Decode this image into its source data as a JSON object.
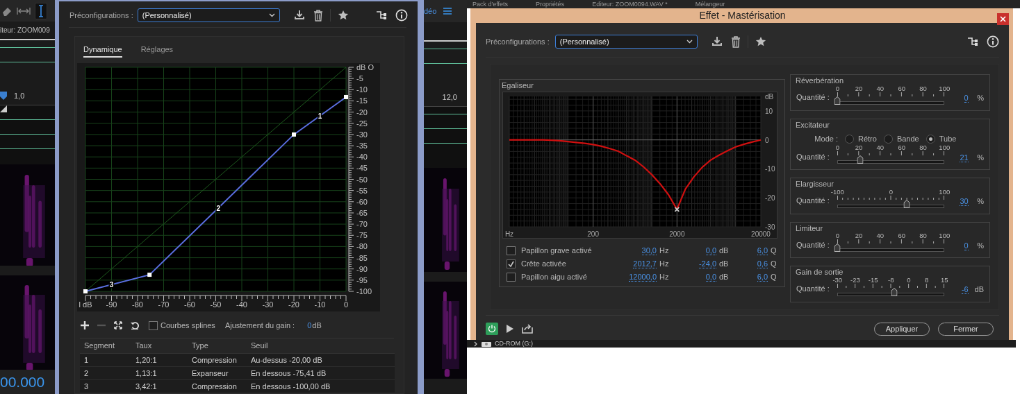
{
  "background": {
    "left_strip": {
      "editor_label": "iteur: ZOOM009",
      "ruler_label": "1,0",
      "time": "00.000"
    },
    "right_strip": {
      "tab_label": "déo",
      "ruler_label": "12,0"
    },
    "top_tabs": [
      "Pack d'effets",
      "Propriétés",
      "Editeur: ZOOM0094.WAV *",
      "Mélangeur"
    ],
    "drive": "CD-ROM (G:)"
  },
  "dynamics_dialog": {
    "presets_label": "Préconfigurations :",
    "preset": "(Personnalisé)",
    "tabs": [
      {
        "label": "Dynamique",
        "selected": true
      },
      {
        "label": "Réglages",
        "selected": false
      }
    ],
    "chart_data": {
      "type": "line",
      "grid": true,
      "x": [
        -100,
        -75.41,
        -20,
        0
      ],
      "series": [
        {
          "color": "#5a6ee0",
          "marker": "square",
          "values": [
            -100,
            -92.6,
            -30,
            -13.3
          ]
        },
        {
          "color": "#1d5a1d",
          "values": [
            -100,
            -75.4,
            -20,
            0
          ]
        }
      ],
      "xlim": [
        -100,
        0
      ],
      "ylim": [
        -100,
        0
      ],
      "xticks": [
        {
          "value": -100,
          "label": "l dB"
        },
        -90,
        -80,
        -70,
        -60,
        -50,
        -40,
        -30,
        -20,
        -10,
        0
      ],
      "yticks": [
        {
          "value": 0,
          "label": "dB O"
        },
        -5,
        -10,
        -15,
        -20,
        -25,
        -30,
        -35,
        -40,
        -45,
        -50,
        -55,
        -60,
        -65,
        -70,
        -75,
        -80,
        -85,
        -90,
        -95,
        -100
      ],
      "annotations": [
        {
          "text": "1",
          "x": -10,
          "y": -21.7
        },
        {
          "text": "2",
          "x": -49,
          "y": -62.8
        },
        {
          "text": "3",
          "x": -90,
          "y": -96.9
        }
      ]
    },
    "tools": [
      {
        "kind": "add",
        "disabled": false
      },
      {
        "kind": "remove",
        "disabled": true
      },
      {
        "kind": "fit",
        "disabled": false
      },
      {
        "kind": "reset",
        "disabled": false
      }
    ],
    "splines": {
      "label": "Courbes splines",
      "checked": false
    },
    "gain_label": "Ajustement du gain :",
    "gain_value": "0",
    "gain_unit": "dB",
    "table": {
      "columns": [
        "Segment",
        "Taux",
        "Type",
        "Seuil"
      ],
      "rows": [
        [
          "1",
          "1,20:1",
          "Compression",
          "Au-dessus -20,00 dB"
        ],
        [
          "2",
          "1,13:1",
          "Expanseur",
          "En dessous -75,41 dB"
        ],
        [
          "3",
          "3,42:1",
          "Compression",
          "En dessous -100,00 dB"
        ]
      ]
    }
  },
  "mastering_dialog": {
    "title": "Effet - Mastérisation",
    "presets_label": "Préconfigurations :",
    "preset": "(Personnalisé)",
    "equalizer": {
      "title": "Egaliseur",
      "chart_data": {
        "type": "line",
        "grid": true,
        "categories": [
          "Hz",
          null,
          null,
          null,
          null,
          null,
          null,
          null,
          null,
          null,
          "200",
          null,
          null,
          null,
          null,
          null,
          null,
          null,
          null,
          null,
          "2000",
          null,
          null,
          null,
          null,
          null,
          null,
          null,
          null,
          null,
          "20000"
        ],
        "series": [
          {
            "color": "#d01010",
            "values": [
              0,
              0,
              0,
              0,
              0,
              -0.1,
              -0.3,
              -0.6,
              -0.9,
              -1.2,
              -1.6,
              -2.2,
              -3,
              -3.9,
              -5.5,
              -7,
              -9.3,
              -12,
              -15.2,
              -19,
              -24,
              -17,
              -12.8,
              -9.5,
              -7,
              -5.3,
              -3.8,
              -2.4,
              -1.5,
              -0.7,
              0
            ]
          },
          {
            "color": "#cccccc",
            "marker": "cross",
            "values": [
              null,
              null,
              null,
              null,
              null,
              null,
              null,
              null,
              null,
              null,
              null,
              null,
              null,
              null,
              null,
              null,
              null,
              null,
              null,
              null,
              -24,
              null,
              null,
              null,
              null,
              null,
              null,
              null,
              null,
              null,
              null
            ]
          }
        ],
        "ylim": [
          -30,
          15
        ],
        "yticks": [
          {
            "value": 15,
            "label": "dB"
          },
          10,
          0,
          -10,
          -20,
          -30
        ]
      },
      "bands": [
        {
          "label": "Papillon grave activé",
          "checked": false,
          "frequency": "30,0",
          "frequency_unit": "Hz",
          "gain": "0,0",
          "gain_unit": "dB",
          "q": "6,0",
          "q_unit": "Q"
        },
        {
          "label": "Crête activée",
          "checked": true,
          "frequency": "2012,7",
          "frequency_unit": "Hz",
          "gain": "-24,0",
          "gain_unit": "dB",
          "q": "0,6",
          "q_unit": "Q"
        },
        {
          "label": "Papillon aigu activé",
          "checked": false,
          "frequency": "12000,0",
          "frequency_unit": "Hz",
          "gain": "0,0",
          "gain_unit": "dB",
          "q": "6,0",
          "q_unit": "Q"
        }
      ]
    },
    "sections": [
      {
        "title": "Réverbération",
        "amount_label": "Quantité :",
        "ticks": [
          "0",
          "20",
          "40",
          "60",
          "80",
          "100"
        ],
        "level": 0,
        "value": "0",
        "unit": "%"
      },
      {
        "title": "Excitateur",
        "mode_label": "Mode :",
        "modes": [
          {
            "label": "Rétro",
            "selected": false
          },
          {
            "label": "Bande",
            "selected": false
          },
          {
            "label": "Tube",
            "selected": true
          }
        ],
        "amount_label": "Quantité :",
        "ticks": [
          "0",
          "20",
          "40",
          "60",
          "80",
          "100"
        ],
        "level": 0.21,
        "value": "21",
        "unit": "%"
      },
      {
        "title": "Elargisseur",
        "amount_label": "Quantité :",
        "ticks": [
          "-100",
          "0",
          "100"
        ],
        "level": 0.65,
        "value": "30",
        "unit": "%"
      },
      {
        "title": "Limiteur",
        "amount_label": "Quantité :",
        "ticks": [
          "0",
          "20",
          "40",
          "60",
          "80",
          "100"
        ],
        "level": 0,
        "value": "0",
        "unit": "%"
      },
      {
        "title": "Gain de sortie",
        "amount_label": "Quantité :",
        "ticks": [
          "-30",
          "-23",
          "-15",
          "-8",
          "0",
          "8",
          "15"
        ],
        "level": 0.533,
        "value": "-6",
        "unit": "dB"
      }
    ],
    "power": {
      "on": true
    },
    "buttons": [
      "Appliquer",
      "Fermer"
    ]
  }
}
